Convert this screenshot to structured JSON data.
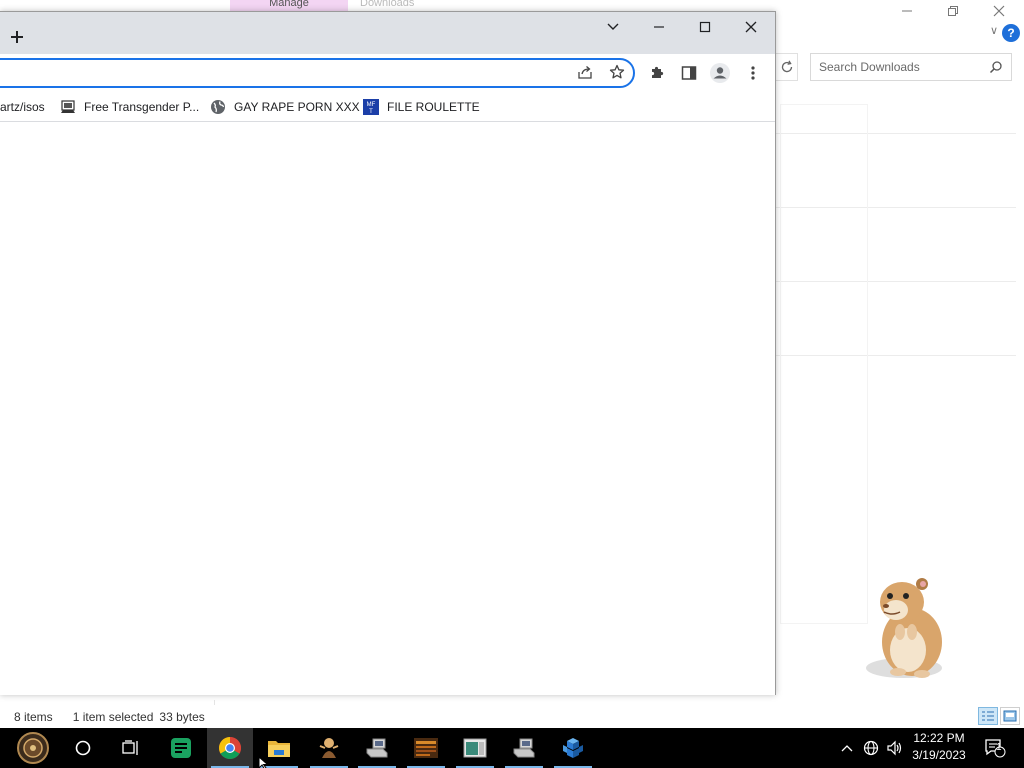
{
  "explorer": {
    "ribbon_tabs": {
      "manage": "Manage",
      "downloads": "Downloads"
    },
    "search_placeholder": "Search Downloads",
    "status": {
      "items": "8 items",
      "selected": "1 item selected",
      "size": "33 bytes"
    }
  },
  "chrome": {
    "bookmarks": [
      {
        "label": "artz/isos",
        "icon": "folder-icon"
      },
      {
        "label": "Free Transgender P...",
        "icon": "site-icon"
      },
      {
        "label": "GAY RAPE PORN XXX",
        "icon": "globe-icon"
      },
      {
        "label": "FILE ROULETTE",
        "icon": "mft-icon"
      }
    ]
  },
  "taskbar": {
    "apps": [
      "start",
      "cortana",
      "task-view",
      "spreadsheet-app",
      "chrome",
      "file-explorer",
      "app-figure",
      "app-computer",
      "app-game",
      "app-window",
      "app-computer-2",
      "app-blocks"
    ],
    "clock": {
      "time": "12:22 PM",
      "date": "3/19/2023"
    },
    "notifications_count": "1"
  },
  "colors": {
    "accent": "#1a73e8",
    "taskbar": "#000000",
    "chrome_frame": "#dee1e6"
  }
}
